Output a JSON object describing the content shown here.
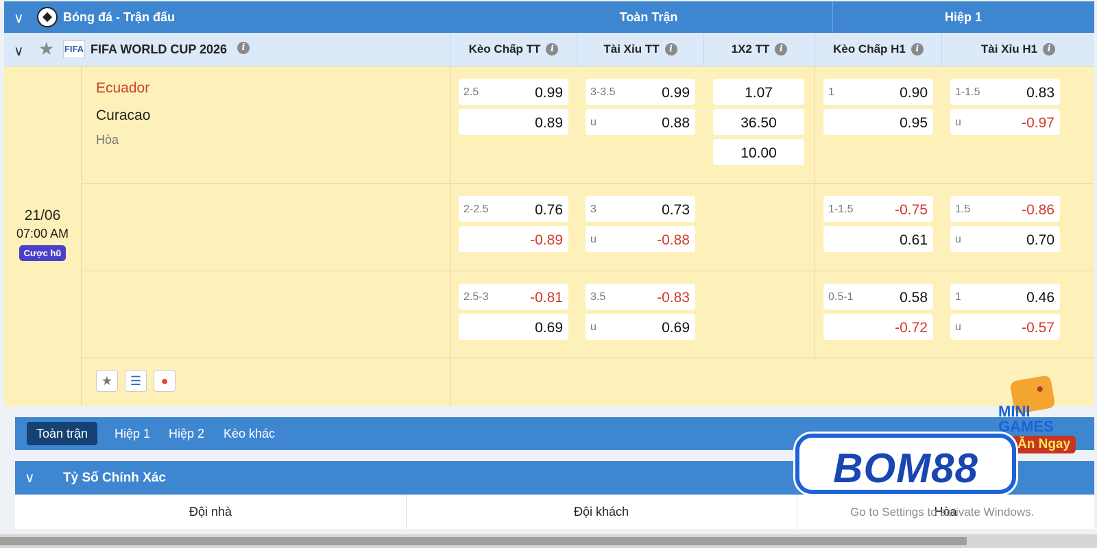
{
  "header": {
    "sport_title": "Bóng đá - Trận đấu",
    "full_match_label": "Toàn Trận",
    "half1_label": "Hiệp 1"
  },
  "league": {
    "name": "FIFA WORLD CUP 2026",
    "logo_text": "FIFA",
    "columns": [
      "Kèo Chấp TT",
      "Tài Xỉu TT",
      "1X2 TT",
      "Kèo Chấp H1",
      "Tài Xỉu H1"
    ]
  },
  "match": {
    "home": "Ecuador",
    "away": "Curacao",
    "draw": "Hòa",
    "date": "21/06",
    "time": "07:00 AM",
    "badge": "Cược hũ"
  },
  "odds": {
    "row1": {
      "hdp_ft": {
        "line": "2.5",
        "home": "0.99",
        "away": "0.89"
      },
      "ou_ft": {
        "line": "3-3.5",
        "over": "0.99",
        "under_label": "u",
        "under": "0.88"
      },
      "x12_ft": {
        "home": "1.07",
        "away": "36.50",
        "draw": "10.00"
      },
      "hdp_h1": {
        "line": "1",
        "home": "0.90",
        "away": "0.95"
      },
      "ou_h1": {
        "line": "1-1.5",
        "over": "0.83",
        "under_label": "u",
        "under": "-0.97"
      }
    },
    "row2": {
      "hdp_ft": {
        "line": "2-2.5",
        "home": "0.76",
        "away": "-0.89"
      },
      "ou_ft": {
        "line": "3",
        "over": "0.73",
        "under_label": "u",
        "under": "-0.88"
      },
      "hdp_h1": {
        "line": "1-1.5",
        "home": "-0.75",
        "away": "0.61"
      },
      "ou_h1": {
        "line": "1.5",
        "over": "-0.86",
        "under_label": "u",
        "under": "0.70"
      }
    },
    "row3": {
      "hdp_ft": {
        "line": "2.5-3",
        "home": "-0.81",
        "away": "0.69"
      },
      "ou_ft": {
        "line": "3.5",
        "over": "-0.83",
        "under_label": "u",
        "under": "0.69"
      },
      "hdp_h1": {
        "line": "0.5-1",
        "home": "0.58",
        "away": "-0.72"
      },
      "ou_h1": {
        "line": "1",
        "over": "0.46",
        "under_label": "u",
        "under": "-0.57"
      }
    }
  },
  "tabs": [
    "Toàn trận",
    "Hiệp 1",
    "Hiệp 2",
    "Kèo khác"
  ],
  "exact_score": {
    "title": "Tỷ Số Chính Xác",
    "columns": [
      "Đội nhà",
      "Đội khách",
      "Hòa"
    ]
  },
  "watermark": "Go to Settings to activate Windows.",
  "promo": {
    "mini_line1": "MINI",
    "mini_line2": "GAMES",
    "mini_line3": "Ăn Ngay",
    "brand": "BOM88"
  },
  "colors": {
    "header_blue": "#3f86d1",
    "row_yellow": "#fdf0b8",
    "negative_red": "#d33a2b",
    "home_team_red": "#c8432a",
    "badge_purple": "#4a3fc9"
  },
  "icons": [
    "chevron-down-icon",
    "soccer-ball-icon",
    "star-icon",
    "info-icon",
    "coins-icon",
    "fire-icon"
  ]
}
